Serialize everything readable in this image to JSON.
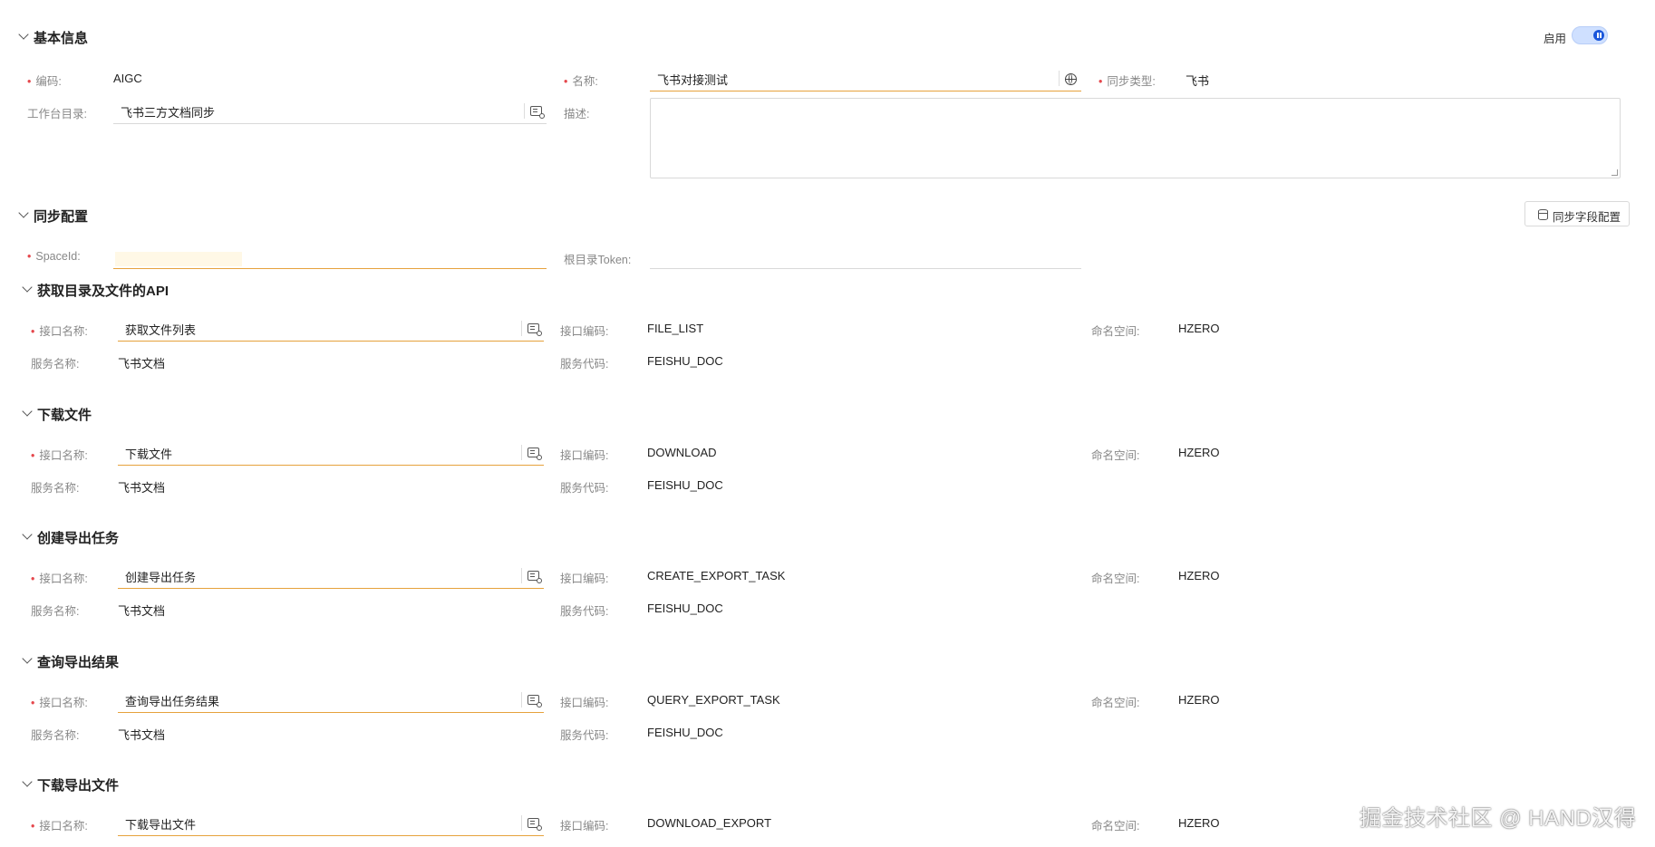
{
  "basic": {
    "title": "基本信息",
    "enable_label": "启用",
    "code_label": "编码:",
    "code_value": "AIGC",
    "name_label": "名称:",
    "name_value": "飞书对接测试",
    "sync_type_label": "同步类型:",
    "sync_type_value": "飞书",
    "dir_label": "工作台目录:",
    "dir_value": "飞书三方文档同步",
    "desc_label": "描述:",
    "desc_value": ""
  },
  "sync": {
    "title": "同步配置",
    "field_config_button": "同步字段配置",
    "space_id_label": "SpaceId:",
    "space_id_value": "",
    "root_token_label": "根目录Token:",
    "root_token_value": ""
  },
  "api_labels": {
    "interface_name": "接口名称:",
    "interface_code": "接口编码:",
    "namespace": "命名空间:",
    "service_name": "服务名称:",
    "service_code": "服务代码:"
  },
  "apis": [
    {
      "title": "获取目录及文件的API",
      "interface_name": "获取文件列表",
      "interface_code": "FILE_LIST",
      "namespace": "HZERO",
      "service_name": "飞书文档",
      "service_code": "FEISHU_DOC"
    },
    {
      "title": "下载文件",
      "interface_name": "下载文件",
      "interface_code": "DOWNLOAD",
      "namespace": "HZERO",
      "service_name": "飞书文档",
      "service_code": "FEISHU_DOC"
    },
    {
      "title": "创建导出任务",
      "interface_name": "创建导出任务",
      "interface_code": "CREATE_EXPORT_TASK",
      "namespace": "HZERO",
      "service_name": "飞书文档",
      "service_code": "FEISHU_DOC"
    },
    {
      "title": "查询导出结果",
      "interface_name": "查询导出任务结果",
      "interface_code": "QUERY_EXPORT_TASK",
      "namespace": "HZERO",
      "service_name": "飞书文档",
      "service_code": "FEISHU_DOC"
    },
    {
      "title": "下载导出文件",
      "interface_name": "下载导出文件",
      "interface_code": "DOWNLOAD_EXPORT",
      "namespace": "HZERO",
      "service_name": "",
      "service_code": ""
    }
  ],
  "watermark": "掘金技术社区 @ HAND汉得"
}
